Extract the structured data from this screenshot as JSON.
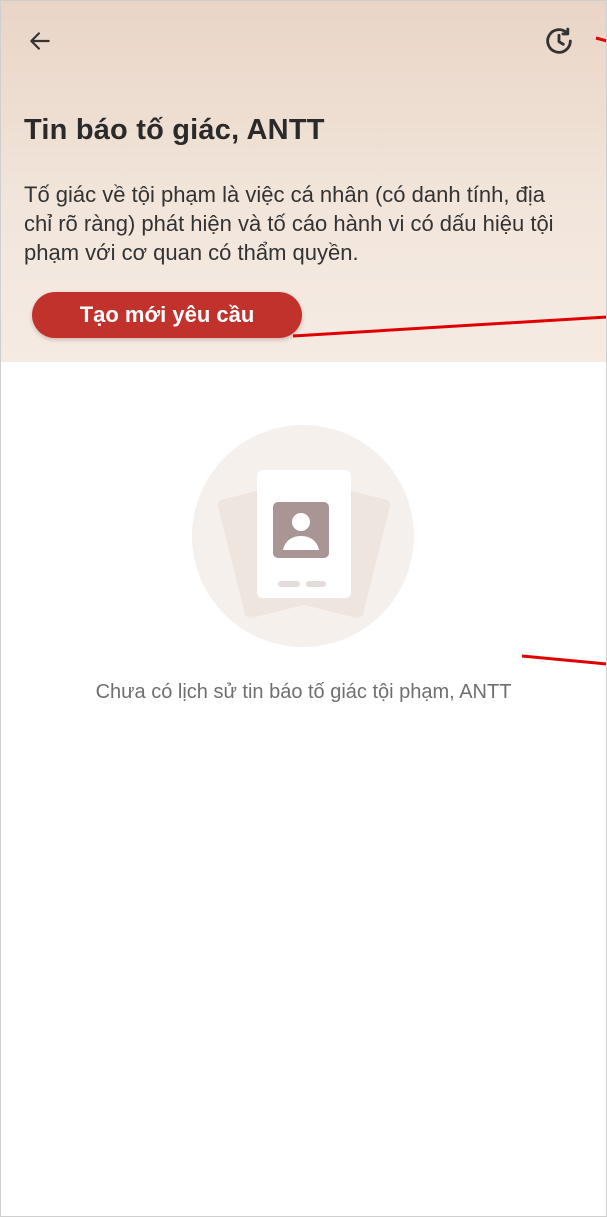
{
  "header": {
    "back_icon": "arrow-left-icon",
    "history_icon": "history-clock-icon",
    "title": "Tin báo tố giác, ANTT",
    "description": "Tố giác về tội phạm là việc cá nhân (có danh tính, địa chỉ rõ ràng) phát hiện và tố cáo hành vi có dấu hiệu tội phạm với cơ quan có thẩm quyền.",
    "create_button_label": "Tạo mới yêu cầu"
  },
  "empty_state": {
    "illustration_icon": "profile-card-icon",
    "message": "Chưa có lịch sử tin báo tố giác tội phạm, ANTT"
  },
  "colors": {
    "accent": "#c1322d",
    "header_bg_top": "#e9d5c6",
    "header_bg_bottom": "#f5ebe3",
    "annotation_red": "#e00000"
  }
}
